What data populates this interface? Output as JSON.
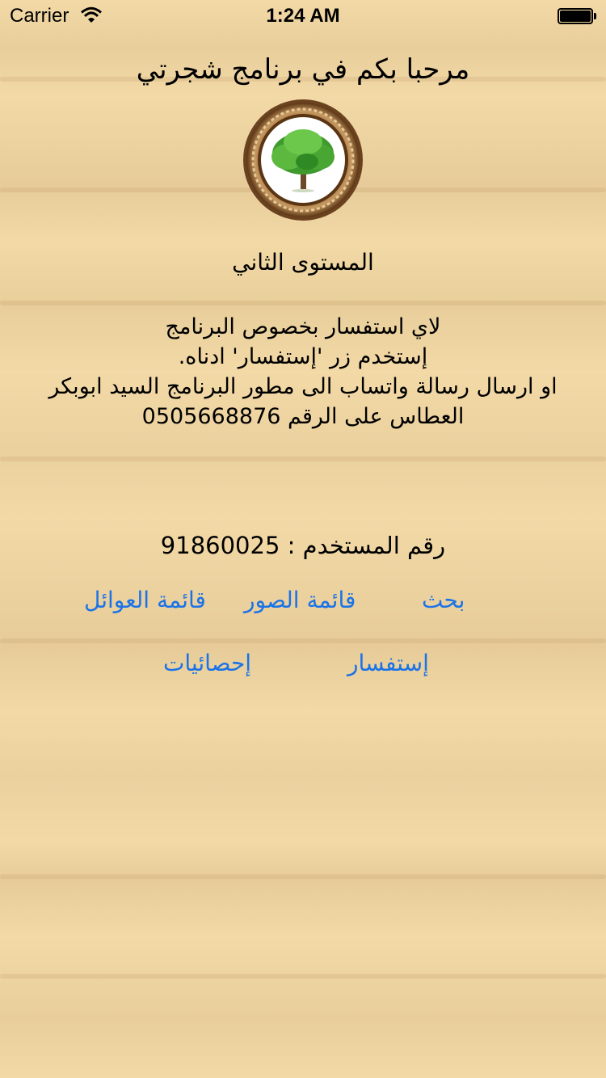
{
  "status_bar": {
    "carrier": "Carrier",
    "time": "1:24 AM",
    "wifi_icon": "wifi-icon",
    "battery_level": 1.0
  },
  "title": "مرحبا بكم في برنامج شجرتي",
  "logo_icon": "tree-icon",
  "level": "المستوى الثاني",
  "info_lines": [
    "لاي استفسار بخصوص البرنامج",
    "إستخدم زر 'إستفسار' ادناه.",
    "او ارسال رسالة واتساب الى مطور البرنامج السيد ابوبكر",
    "العطاس على الرقم 0505668876"
  ],
  "user": {
    "label": "رقم المستخدم :",
    "number": "91860025"
  },
  "buttons": {
    "search": "بحث",
    "photos": "قائمة الصور",
    "families": "قائمة العوائل",
    "inquiry": "إستفسار",
    "stats": "إحصائيات"
  },
  "colors": {
    "link": "#1a73e8",
    "background": "#f2d9a6"
  }
}
